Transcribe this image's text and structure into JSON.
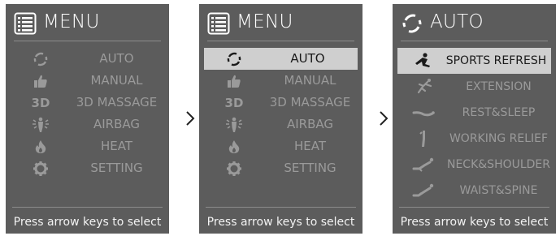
{
  "screens": [
    {
      "title": "MENU",
      "title_icon": "list-icon",
      "items": [
        {
          "label": "AUTO",
          "icon": "refresh-icon",
          "selected": false
        },
        {
          "label": "MANUAL",
          "icon": "thumbs-up-icon",
          "selected": false
        },
        {
          "label": "3D MASSAGE",
          "icon": "3d-icon",
          "selected": false
        },
        {
          "label": "AIRBAG",
          "icon": "airbag-icon",
          "selected": false
        },
        {
          "label": "HEAT",
          "icon": "flame-icon",
          "selected": false
        },
        {
          "label": "SETTING",
          "icon": "gear-icon",
          "selected": false
        }
      ],
      "footer": "Press arrow keys to select"
    },
    {
      "title": "MENU",
      "title_icon": "list-icon",
      "items": [
        {
          "label": "AUTO",
          "icon": "refresh-icon",
          "selected": true
        },
        {
          "label": "MANUAL",
          "icon": "thumbs-up-icon",
          "selected": false
        },
        {
          "label": "3D MASSAGE",
          "icon": "3d-icon",
          "selected": false
        },
        {
          "label": "AIRBAG",
          "icon": "airbag-icon",
          "selected": false
        },
        {
          "label": "HEAT",
          "icon": "flame-icon",
          "selected": false
        },
        {
          "label": "SETTING",
          "icon": "gear-icon",
          "selected": false
        }
      ],
      "footer": "Press arrow keys to select"
    },
    {
      "title": "AUTO",
      "title_icon": "refresh-icon",
      "items": [
        {
          "label": "SPORTS REFRESH",
          "icon": "sports-pose-icon",
          "selected": true
        },
        {
          "label": "EXTENSION",
          "icon": "extension-pose-icon",
          "selected": false
        },
        {
          "label": "REST&SLEEP",
          "icon": "rest-pose-icon",
          "selected": false
        },
        {
          "label": "WORKING RELIEF",
          "icon": "working-pose-icon",
          "selected": false
        },
        {
          "label": "NECK&SHOULDER",
          "icon": "neck-pose-icon",
          "selected": false
        },
        {
          "label": "WAIST&SPINE",
          "icon": "waist-pose-icon",
          "selected": false
        }
      ],
      "footer": "Press arrow keys to select"
    }
  ],
  "icons": {
    "3d_text": "3D"
  },
  "colors": {
    "panel_bg": "#5c5c5c",
    "selected_bg": "#cfcfcf",
    "item_text": "#9a9a9a",
    "selected_text": "#1a1a1a",
    "divider": "#8c8c8c"
  }
}
